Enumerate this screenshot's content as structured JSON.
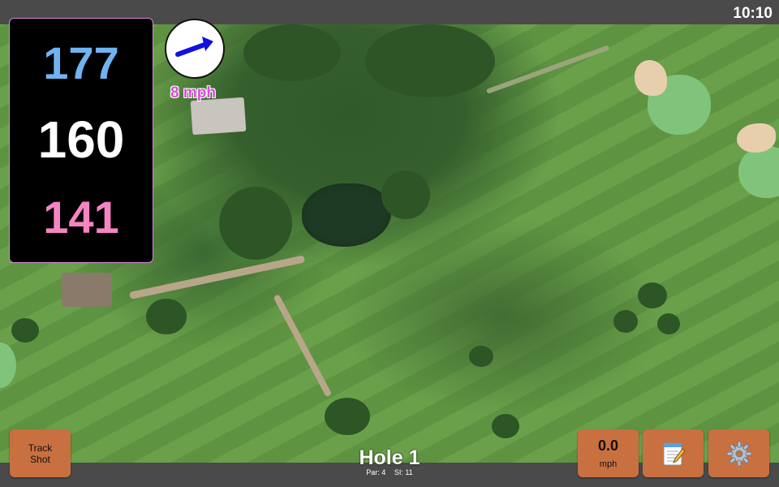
{
  "status_bar": {
    "time": "10:10"
  },
  "distances": {
    "back": "177",
    "middle": "160",
    "front": "141"
  },
  "wind": {
    "speed_label": "8 mph",
    "direction_icon": "arrow-right-icon"
  },
  "hole": {
    "title": "Hole 1",
    "par_label": "Par: 4",
    "si_label": "SI: 11"
  },
  "buttons": {
    "track_shot_line1": "Track",
    "track_shot_line2": "Shot",
    "speed_value": "0.0",
    "speed_unit": "mph",
    "notes_icon": "notepad-icon",
    "settings_icon": "gear-icon"
  },
  "colors": {
    "back_distance": "#6fb4f0",
    "middle_distance": "#ffffff",
    "front_distance": "#f584c3",
    "wind_text": "#d64fd6",
    "button_bg": "#c97040",
    "bar_bg": "#4a4a4a"
  }
}
